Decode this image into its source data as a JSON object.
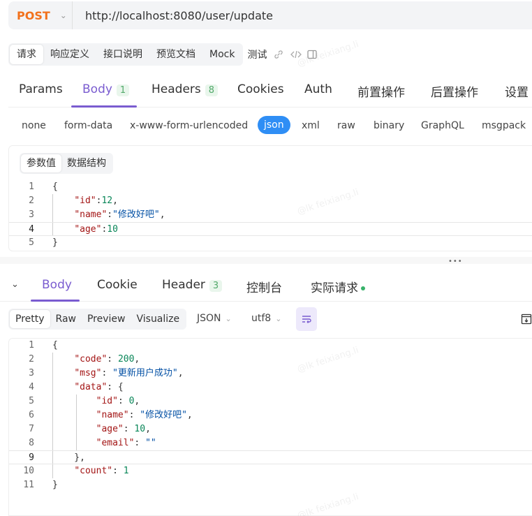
{
  "url_bar": {
    "method": "POST",
    "url": "http://localhost:8080/user/update"
  },
  "request_tabs": {
    "items": [
      "请求",
      "响应定义",
      "接口说明",
      "预览文档",
      "Mock"
    ],
    "test_label": "测试"
  },
  "main_tabs": [
    {
      "label": "Params"
    },
    {
      "label": "Body",
      "count": "1"
    },
    {
      "label": "Headers",
      "count": "8"
    },
    {
      "label": "Cookies"
    },
    {
      "label": "Auth"
    },
    {
      "label": "前置操作"
    },
    {
      "label": "后置操作"
    },
    {
      "label": "设置"
    }
  ],
  "body_types": [
    "none",
    "form-data",
    "x-www-form-urlencoded",
    "json",
    "xml",
    "raw",
    "binary",
    "GraphQL",
    "msgpack"
  ],
  "request_editor": {
    "sub_tabs": [
      "参数值",
      "数据结构"
    ],
    "line_numbers": [
      "1",
      "2",
      "3",
      "4",
      "5"
    ]
  },
  "request_body": {
    "id": "12",
    "name": "\"修改好吧\"",
    "age": "10"
  },
  "response_tabs": [
    {
      "label": "Body"
    },
    {
      "label": "Cookie"
    },
    {
      "label": "Header",
      "count": "3"
    },
    {
      "label": "控制台"
    },
    {
      "label": "实际请求"
    }
  ],
  "response_view": {
    "modes": [
      "Pretty",
      "Raw",
      "Preview",
      "Visualize"
    ],
    "format": "JSON",
    "encoding": "utf8"
  },
  "response_body": {
    "code": "200",
    "msg": "\"更新用户成功\"",
    "data_id": "0",
    "data_name": "\"修改好吧\"",
    "data_age": "10",
    "data_email": "\"\"",
    "count": "1",
    "line_numbers": [
      "1",
      "2",
      "3",
      "4",
      "5",
      "6",
      "7",
      "8",
      "9",
      "10",
      "11"
    ]
  },
  "watermark": "@lk feixiang.li",
  "colors": {
    "accent": "#7a5cd0",
    "method": "#f2711c",
    "json_active": "#2f8ef5",
    "status_dot": "#38b26a"
  }
}
